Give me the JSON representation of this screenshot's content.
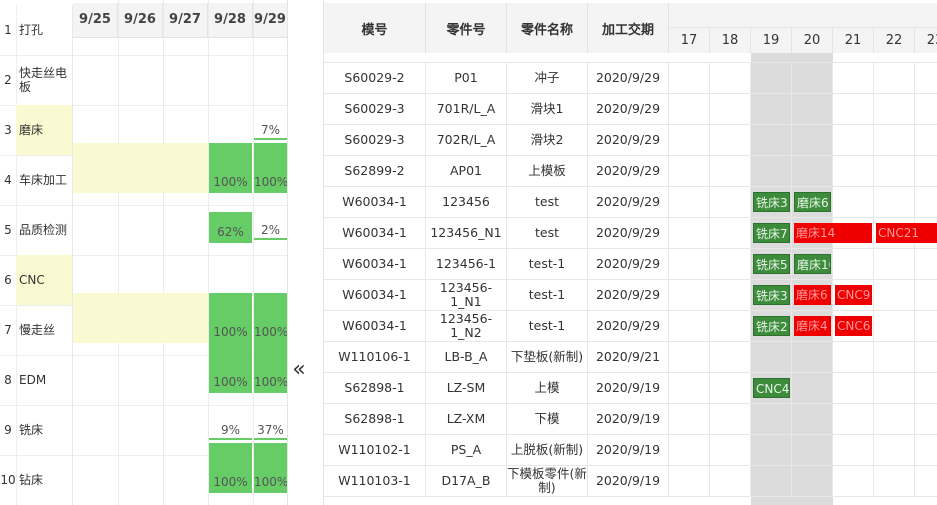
{
  "capacity": {
    "dates": [
      "9/25",
      "9/26",
      "9/27",
      "9/28",
      "9/29"
    ],
    "processes": [
      {
        "num": "1",
        "name": "打孔",
        "highlight": false
      },
      {
        "num": "2",
        "name": "快走丝电板",
        "highlight": false
      },
      {
        "num": "3",
        "name": "磨床",
        "highlight": true
      },
      {
        "num": "4",
        "name": "车床加工",
        "highlight": false
      },
      {
        "num": "5",
        "name": "品质检测",
        "highlight": false
      },
      {
        "num": "6",
        "name": "CNC",
        "highlight": true
      },
      {
        "num": "7",
        "name": "慢走丝",
        "highlight": false
      },
      {
        "num": "8",
        "name": "EDM",
        "highlight": false
      },
      {
        "num": "9",
        "name": "铣床",
        "highlight": false
      },
      {
        "num": "10",
        "name": "钻床",
        "highlight": false
      }
    ],
    "loads": [
      {
        "row": 3,
        "date": 4,
        "label": "7%",
        "percent": 7
      },
      {
        "row": 4,
        "date": 3,
        "label": "100%",
        "percent": 100
      },
      {
        "row": 4,
        "date": 4,
        "label": "100%",
        "percent": 100
      },
      {
        "row": 5,
        "date": 3,
        "label": "62%",
        "percent": 62
      },
      {
        "row": 5,
        "date": 4,
        "label": "2%",
        "percent": 2
      },
      {
        "row": 7,
        "date": 3,
        "label": "100%",
        "percent": 100
      },
      {
        "row": 7,
        "date": 4,
        "label": "100%",
        "percent": 100
      },
      {
        "row": 8,
        "date": 3,
        "label": "100%",
        "percent": 100
      },
      {
        "row": 8,
        "date": 4,
        "label": "100%",
        "percent": 100
      },
      {
        "row": 9,
        "date": 3,
        "label": "9%",
        "percent": 9
      },
      {
        "row": 9,
        "date": 4,
        "label": "37%",
        "percent": 37
      },
      {
        "row": 10,
        "date": 3,
        "label": "100%",
        "percent": 100
      },
      {
        "row": 10,
        "date": 4,
        "label": "100%",
        "percent": 100
      }
    ],
    "highlighted_spans": [
      {
        "row": 4,
        "from": 0,
        "to": 3
      },
      {
        "row": 7,
        "from": 0,
        "to": 3
      }
    ]
  },
  "collapse_icon": "«",
  "table": {
    "headers": {
      "mold": "模号",
      "part": "零件号",
      "name": "零件名称",
      "due": "加工交期"
    },
    "days": [
      "17",
      "18",
      "19",
      "20",
      "21",
      "22",
      "23"
    ],
    "rows": [
      {
        "mold": "S60029-2",
        "part": "P01",
        "name": "冲子",
        "due": "2020/9/29"
      },
      {
        "mold": "S60029-3",
        "part": "701R/L_A",
        "name": "滑块1",
        "due": "2020/9/29"
      },
      {
        "mold": "S60029-3",
        "part": "702R/L_A",
        "name": "滑块2",
        "due": "2020/9/29"
      },
      {
        "mold": "S62899-2",
        "part": "AP01",
        "name": "上模板",
        "due": "2020/9/29"
      },
      {
        "mold": "W60034-1",
        "part": "123456",
        "name": "test",
        "due": "2020/9/29"
      },
      {
        "mold": "W60034-1",
        "part": "123456_N1",
        "name": "test",
        "due": "2020/9/29"
      },
      {
        "mold": "W60034-1",
        "part": "123456-1",
        "name": "test-1",
        "due": "2020/9/29"
      },
      {
        "mold": "W60034-1",
        "part": "123456-1_N1",
        "name": "test-1",
        "due": "2020/9/29"
      },
      {
        "mold": "W60034-1",
        "part": "123456-1_N2",
        "name": "test-1",
        "due": "2020/9/29"
      },
      {
        "mold": "W110106-1",
        "part": "LB-B_A",
        "name": "下垫板(新制)",
        "due": "2020/9/21"
      },
      {
        "mold": "S62898-1",
        "part": "LZ-SM",
        "name": "上模",
        "due": "2020/9/19"
      },
      {
        "mold": "S62898-1",
        "part": "LZ-XM",
        "name": "下模",
        "due": "2020/9/19"
      },
      {
        "mold": "W110102-1",
        "part": "PS_A",
        "name": "上脱板(新制)",
        "due": "2020/9/19"
      },
      {
        "mold": "W110103-1",
        "part": "D17A_B",
        "name": "下模板零件(新制)",
        "due": "2020/9/19"
      }
    ],
    "tasks": [
      {
        "row": 4,
        "day": 2,
        "span": 1,
        "label": "铣床3",
        "color": "green"
      },
      {
        "row": 4,
        "day": 3,
        "span": 1,
        "label": "磨床6",
        "color": "green"
      },
      {
        "row": 5,
        "day": 2,
        "span": 1,
        "label": "铣床7",
        "color": "green"
      },
      {
        "row": 5,
        "day": 3,
        "span": 2,
        "label": "磨床14",
        "color": "red"
      },
      {
        "row": 5,
        "day": 5,
        "span": 2,
        "label": "CNC21",
        "color": "red"
      },
      {
        "row": 6,
        "day": 2,
        "span": 1,
        "label": "铣床5",
        "color": "green"
      },
      {
        "row": 6,
        "day": 3,
        "span": 1,
        "label": "磨床10",
        "color": "green"
      },
      {
        "row": 7,
        "day": 2,
        "span": 1,
        "label": "铣床3",
        "color": "green"
      },
      {
        "row": 7,
        "day": 3,
        "span": 1,
        "label": "磨床6",
        "color": "red"
      },
      {
        "row": 7,
        "day": 4,
        "span": 1,
        "label": "CNC9",
        "color": "red"
      },
      {
        "row": 8,
        "day": 2,
        "span": 1,
        "label": "铣床2",
        "color": "green"
      },
      {
        "row": 8,
        "day": 3,
        "span": 1,
        "label": "磨床4",
        "color": "red"
      },
      {
        "row": 8,
        "day": 4,
        "span": 1,
        "label": "CNC6",
        "color": "red"
      },
      {
        "row": 10,
        "day": 2,
        "span": 1,
        "label": "CNC4",
        "color": "green"
      }
    ],
    "today_columns": [
      2,
      3
    ]
  },
  "colors": {
    "green": "#66cc66",
    "task_green": "#3c8c3c",
    "task_red": "#ee0000",
    "yellow": "#fafad2",
    "today": "#dcdcdc"
  }
}
